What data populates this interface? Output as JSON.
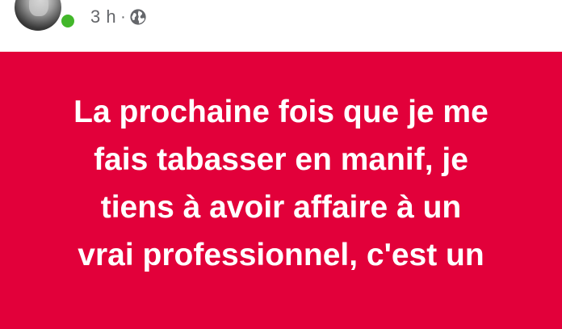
{
  "post": {
    "time": "3 h",
    "separator": "·",
    "privacy_icon": "globe-icon",
    "author_online": true,
    "background_color": "#e2003a",
    "text": "La prochaine fois que je me\nfais tabasser en manif, je\ntiens à avoir affaire à un\nvrai professionnel, c'est un"
  }
}
